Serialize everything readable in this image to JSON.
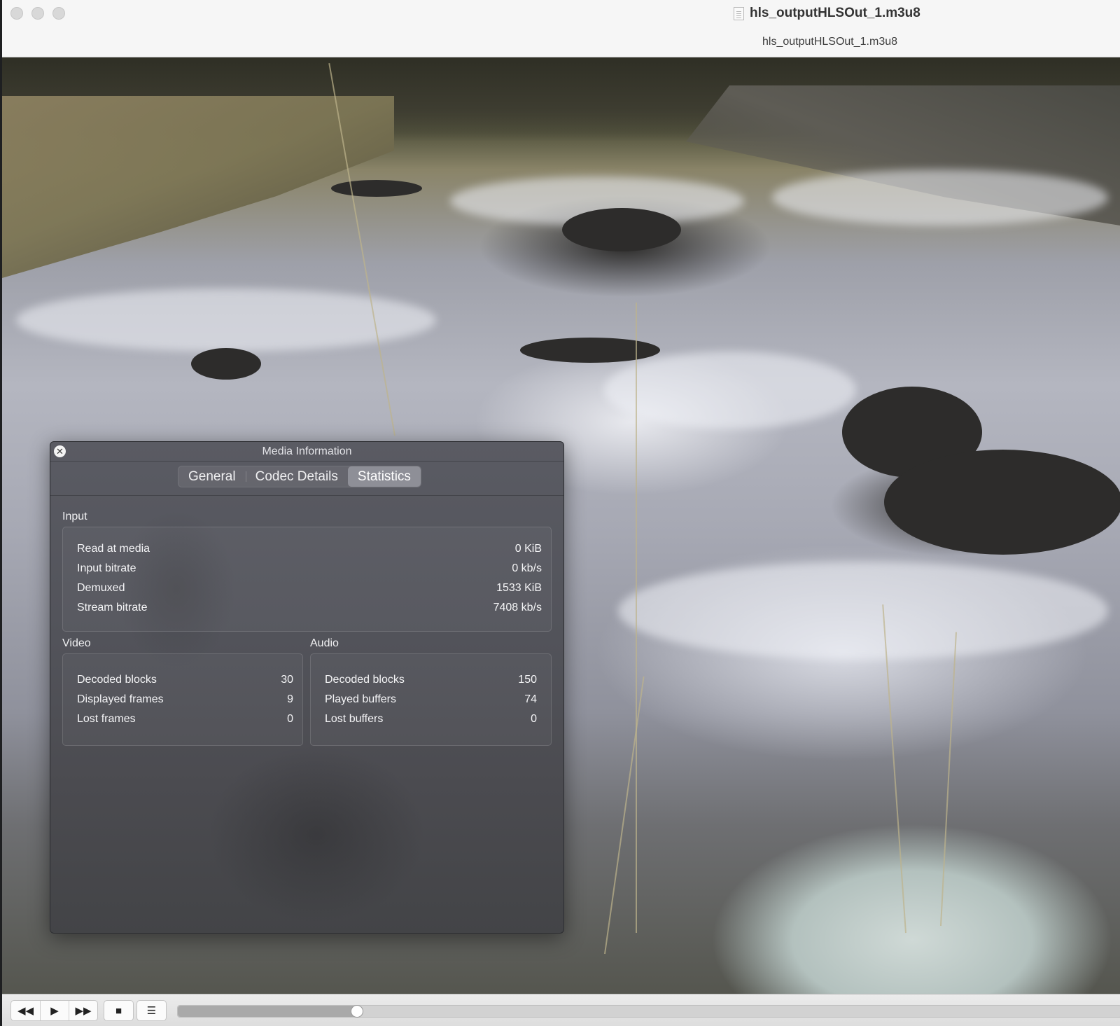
{
  "window": {
    "title": "hls_outputHLSOut_1.m3u8",
    "subtitle": "hls_outputHLSOut_1.m3u8"
  },
  "panel": {
    "title": "Media Information",
    "tabs": [
      "General",
      "Codec Details",
      "Statistics"
    ],
    "active_tab": "Statistics",
    "input": {
      "label": "Input",
      "rows": [
        {
          "label": "Read at media",
          "value": "0 KiB"
        },
        {
          "label": "Input bitrate",
          "value": "0 kb/s"
        },
        {
          "label": "Demuxed",
          "value": "1533 KiB"
        },
        {
          "label": "Stream bitrate",
          "value": "7408 kb/s"
        }
      ]
    },
    "video": {
      "label": "Video",
      "rows": [
        {
          "label": "Decoded blocks",
          "value": "30"
        },
        {
          "label": "Displayed frames",
          "value": "9"
        },
        {
          "label": "Lost frames",
          "value": "0"
        }
      ]
    },
    "audio": {
      "label": "Audio",
      "rows": [
        {
          "label": "Decoded blocks",
          "value": "150"
        },
        {
          "label": "Played buffers",
          "value": "74"
        },
        {
          "label": "Lost buffers",
          "value": "0"
        }
      ]
    }
  },
  "controller": {
    "buttons": [
      "rewind-icon",
      "play-icon",
      "fast-forward-icon",
      "stop-icon",
      "playlist-icon"
    ],
    "progress": 0.19
  }
}
